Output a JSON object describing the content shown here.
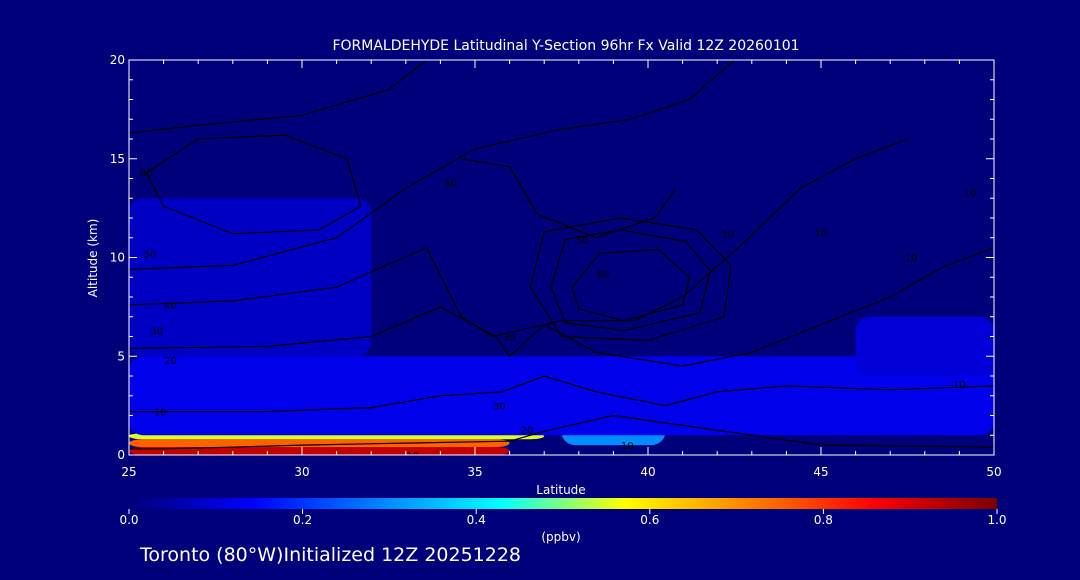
{
  "chart_data": {
    "type": "heatmap",
    "title": "FORMALDEHYDE Latitudinal Y-Section 96hr  Fx Valid 12Z 20260101",
    "xlabel": "Latitude",
    "ylabel": "Altitude (km)",
    "xlim": [
      25,
      50
    ],
    "ylim": [
      0,
      20
    ],
    "x_ticks": [
      25,
      30,
      35,
      40,
      45,
      50
    ],
    "y_ticks": [
      0,
      5,
      10,
      15,
      20
    ],
    "colorbar": {
      "label": "(ppbv)",
      "range": [
        0.0,
        1.0
      ],
      "ticks": [
        "0.0",
        "0.2",
        "0.4",
        "0.6",
        "0.8",
        "1.0"
      ],
      "colors": [
        "#00007a",
        "#0000ff",
        "#0080ff",
        "#00ffff",
        "#ffff00",
        "#ff8000",
        "#ff0000",
        "#7a0000"
      ]
    },
    "field_regions": [
      {
        "lat_range": [
          25,
          36
        ],
        "alt_range": [
          0,
          0.4
        ],
        "value": 0.92
      },
      {
        "lat_range": [
          25,
          36
        ],
        "alt_range": [
          0.4,
          0.8
        ],
        "value": 0.75
      },
      {
        "lat_range": [
          25,
          37
        ],
        "alt_range": [
          0.8,
          1.1
        ],
        "value": 0.55
      },
      {
        "lat_range": [
          37.5,
          40.5
        ],
        "alt_range": [
          0.5,
          1.8
        ],
        "value": 0.3
      },
      {
        "lat_range": [
          25,
          50
        ],
        "alt_range": [
          1,
          5
        ],
        "value": 0.12
      },
      {
        "lat_range": [
          46,
          50
        ],
        "alt_range": [
          4,
          7
        ],
        "value": 0.1
      },
      {
        "lat_range": [
          25,
          32
        ],
        "alt_range": [
          5,
          13
        ],
        "value": 0.08
      }
    ],
    "contour_labels": [
      "10",
      "20",
      "30",
      "40",
      "50",
      "60",
      "70",
      "80"
    ]
  },
  "footer": {
    "text": "Toronto (80°W)Initialized 12Z 20251228"
  }
}
